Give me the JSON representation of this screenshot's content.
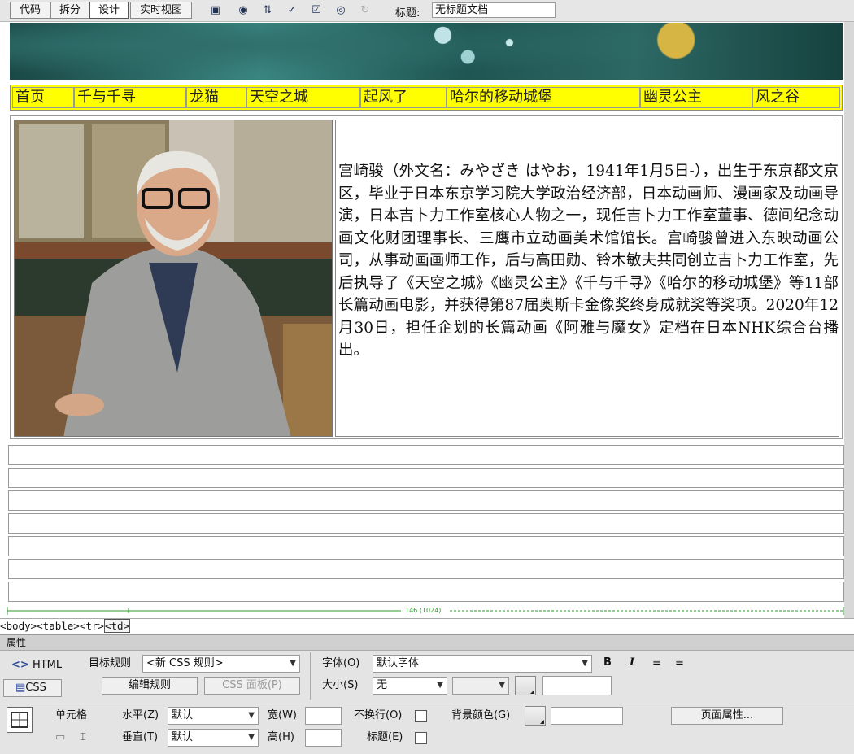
{
  "toolbar": {
    "view_buttons": [
      "代码",
      "拆分",
      "设计",
      "实时视图"
    ],
    "active_view": "设计",
    "icons": [
      "multiscreen-icon",
      "preview-globe-icon",
      "file-transfer-icon",
      "validate-icon",
      "check-page-icon",
      "visual-aids-icon",
      "refresh-icon"
    ],
    "title_label": "标题:",
    "title_value": "无标题文档"
  },
  "page": {
    "nav": [
      "首页",
      "千与千寻",
      "龙猫",
      "天空之城",
      "起风了",
      "哈尔的移动城堡",
      "幽灵公主",
      "风之谷"
    ],
    "bio": "宫崎骏（外文名：みやざき はやお，1941年1月5日-），出生于东京都文京区，毕业于日本东京学习院大学政治经济部，日本动画师、漫画家及动画导演，日本吉卜力工作室核心人物之一，现任吉卜力工作室董事、德间纪念动画文化财团理事长、三鹰市立动画美术馆馆长。宫崎骏曾进入东映动画公司，从事动画画师工作，后与高田勋、铃木敏夫共同创立吉卜力工作室，先后执导了《天空之城》《幽灵公主》《千与千寻》《哈尔的移动城堡》等11部长篇动画电影，并获得第87届奥斯卡金像奖终身成就奖等奖项。2020年12月30日，担任企划的长篇动画《阿雅与魔女》定档在日本NHK综合台播出。",
    "empty_rows": 7,
    "width_guide": "146 (1024)"
  },
  "tag_selector": [
    "<body>",
    "<table>",
    "<tr>",
    "<td>"
  ],
  "properties": {
    "title": "属性",
    "html_label": "HTML",
    "css_label": "CSS",
    "target_rule_label": "目标规则",
    "target_rule_value": "<新 CSS 规则>",
    "edit_rule": "编辑规则",
    "css_panel": "CSS 面板(P)",
    "font_label": "字体(O)",
    "font_value": "默认字体",
    "size_label": "大小(S)",
    "size_value": "无",
    "bold": "B",
    "italic": "I",
    "cell_label": "单元格",
    "horz_label": "水平(Z)",
    "horz_value": "默认",
    "vert_label": "垂直(T)",
    "vert_value": "默认",
    "width_label": "宽(W)",
    "height_label": "高(H)",
    "nowrap_label": "不换行(O)",
    "header_label": "标题(E)",
    "bg_label": "背景颜色(G)",
    "page_props": "页面属性..."
  },
  "colors": {
    "nav_bg": "#ffff00",
    "guide": "#2a9a2a"
  }
}
